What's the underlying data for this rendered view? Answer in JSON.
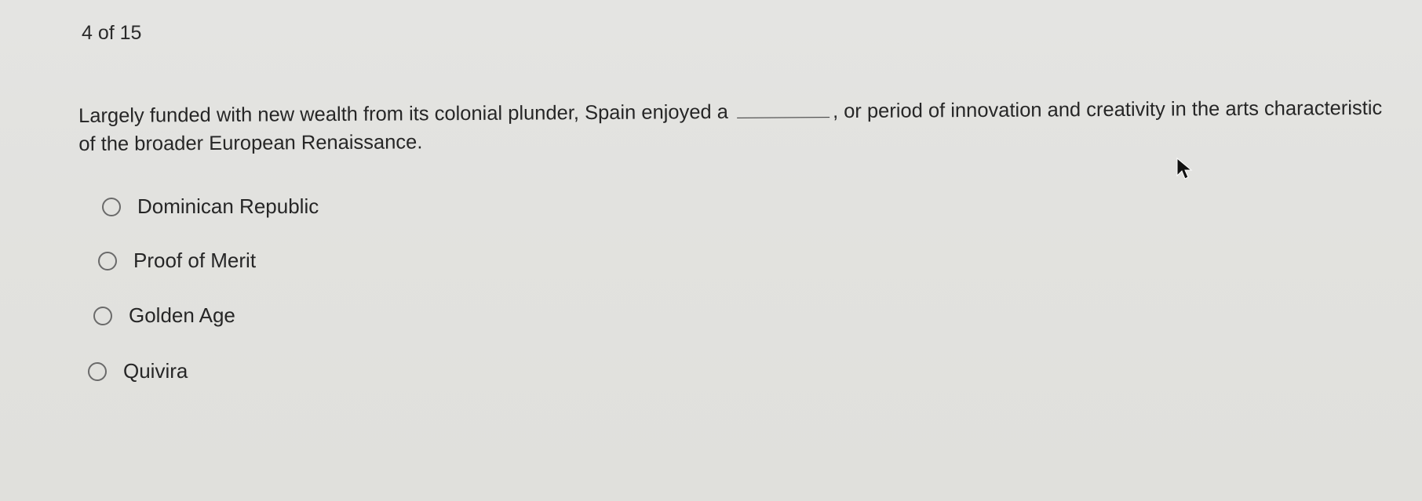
{
  "quiz": {
    "progress": "4 of 15",
    "question_before": "Largely funded with new wealth from its colonial plunder, Spain enjoyed a",
    "question_after": ", or period of innovation and creativity in the arts characteristic of the broader European Renaissance.",
    "options": [
      {
        "label": "Dominican Republic",
        "selected": false
      },
      {
        "label": "Proof of Merit",
        "selected": false
      },
      {
        "label": "Golden Age",
        "selected": false
      },
      {
        "label": "Quivira",
        "selected": false
      }
    ]
  },
  "cursor": {
    "icon": "mouse-pointer-icon"
  }
}
